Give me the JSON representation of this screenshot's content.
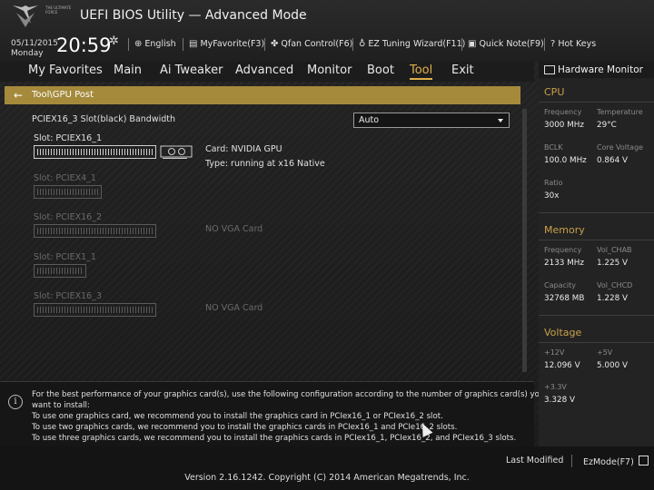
{
  "header": {
    "logo_text": "THE ULTIMATE FORCE",
    "title": "UEFI BIOS Utility — Advanced Mode",
    "date": "05/11/2015",
    "day": "Monday",
    "time": "20:59",
    "toolbar": [
      {
        "icon": "globe-icon",
        "label": "English"
      },
      {
        "icon": "favorite-icon",
        "label": "MyFavorite(F3)"
      },
      {
        "icon": "fan-icon",
        "label": "Qfan Control(F6)"
      },
      {
        "icon": "ez-tuning-icon",
        "label": "EZ Tuning Wizard(F11)"
      },
      {
        "icon": "note-icon",
        "label": "Quick Note(F9)"
      },
      {
        "icon": "help-icon",
        "label": "Hot Keys"
      }
    ]
  },
  "menu": {
    "items": [
      "My Favorites",
      "Main",
      "Ai Tweaker",
      "Advanced",
      "Monitor",
      "Boot",
      "Tool",
      "Exit"
    ],
    "active": "Tool"
  },
  "breadcrumb": "Tool\\GPU Post",
  "setting": {
    "label": "PCIEX16_3 Slot(black) Bandwidth",
    "value": "Auto"
  },
  "slots": [
    {
      "name": "Slot: PCIEX16_1",
      "info1": "Card: NVIDIA GPU",
      "info2": "Type: running at x16 Native",
      "active": true
    },
    {
      "name": "Slot: PCIEX4_1",
      "info1": "",
      "info2": "",
      "active": false
    },
    {
      "name": "Slot: PCIEX16_2",
      "info1": "NO VGA Card",
      "info2": "",
      "active": false
    },
    {
      "name": "Slot: PCIEX1_1",
      "info1": "",
      "info2": "",
      "active": false
    },
    {
      "name": "Slot: PCIEX16_3",
      "info1": "NO VGA Card",
      "info2": "",
      "active": false
    }
  ],
  "info": {
    "lines": [
      "For the best performance of your graphics card(s), use the following configuration according to the number of graphics card(s) you",
      "want to install:",
      "To use one graphics card, we recommend you to install  the graphics card in PCIex16_1 or PCIex16_2 slot.",
      "To use two graphics cards, we recommend you to install the graphics cards in PCIex16_1 and PCIe16_2 slots.",
      "To use three graphics cards, we recommend you to install the graphics cards in PCIex16_1, PCIex16_2, and PCIex16_3 slots."
    ]
  },
  "hw_monitor": {
    "title": "Hardware Monitor",
    "cpu": {
      "title": "CPU",
      "frequency_label": "Frequency",
      "frequency": "3000 MHz",
      "temperature_label": "Temperature",
      "temperature": "29°C",
      "bclk_label": "BCLK",
      "bclk": "100.0 MHz",
      "core_voltage_label": "Core Voltage",
      "core_voltage": "0.864 V",
      "ratio_label": "Ratio",
      "ratio": "30x"
    },
    "memory": {
      "title": "Memory",
      "frequency_label": "Frequency",
      "frequency": "2133 MHz",
      "vol_chab_label": "Vol_CHAB",
      "vol_chab": "1.225 V",
      "capacity_label": "Capacity",
      "capacity": "32768 MB",
      "vol_chcd_label": "Vol_CHCD",
      "vol_chcd": "1.228 V"
    },
    "voltage": {
      "title": "Voltage",
      "v12_label": "+12V",
      "v12": "12.096 V",
      "v5_label": "+5V",
      "v5": "5.000 V",
      "v33_label": "+3.3V",
      "v33": "3.328 V"
    }
  },
  "footer": {
    "last_modified": "Last Modified",
    "ezmode": "EzMode(F7)",
    "version": "Version 2.16.1242. Copyright (C) 2014 American Megatrends, Inc."
  },
  "colors": {
    "accent": "#c9a14a",
    "breadcrumb_bg": "#a58a3c",
    "background": "#1d1d1d"
  }
}
